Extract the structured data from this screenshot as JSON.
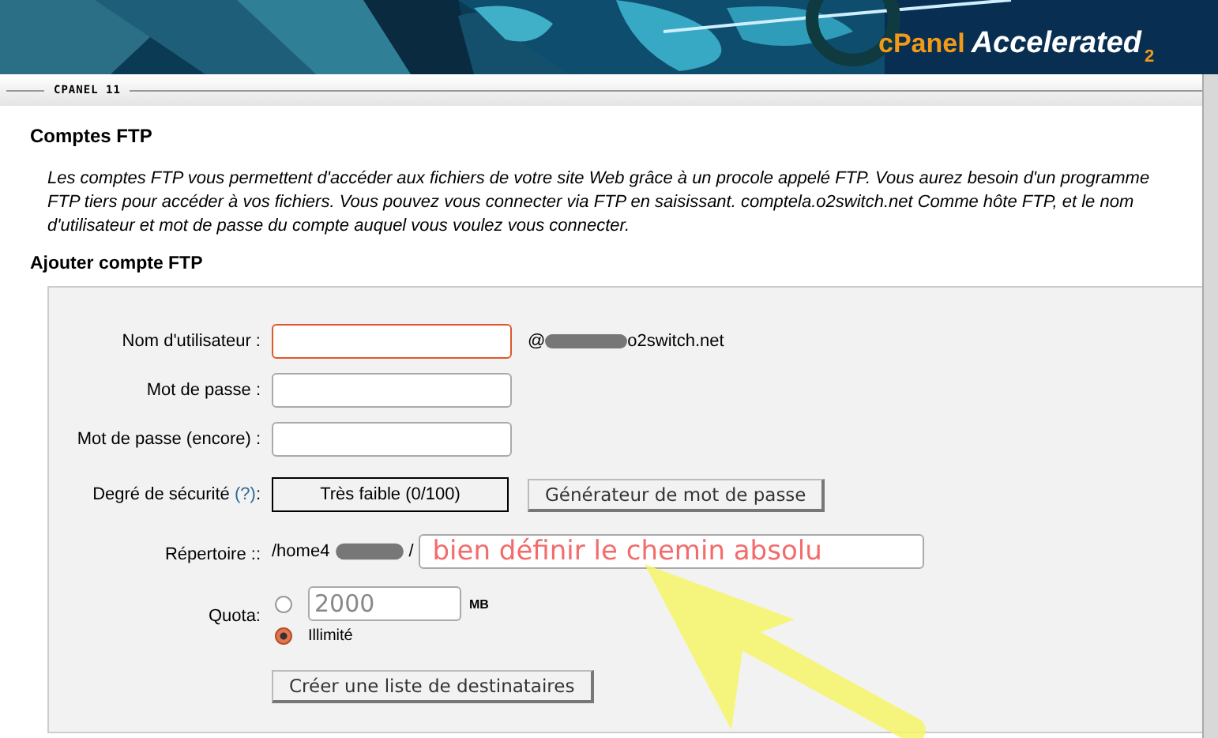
{
  "header": {
    "logo_brand": "cPanel",
    "logo_product": "Accelerated",
    "logo_version": "2",
    "version_tab": "CPANEL 11"
  },
  "page": {
    "title": "Comptes FTP",
    "description": "Les comptes FTP vous permettent d'accéder aux fichiers de votre site Web grâce à un procole appelé FTP. Vous aurez besoin d'un programme FTP tiers pour accéder à vos fichiers. Vous pouvez vous connecter via FTP en saisissant. comptela.o2switch.net Comme hôte FTP, et le nom d'utilisateur et mot de passe du compte auquel vous voulez vous connecter.",
    "section_title": "Ajouter compte FTP"
  },
  "form": {
    "username": {
      "label": "Nom d'utilisateur :",
      "focused": true,
      "domain_prefix": "@",
      "domain_suffix": "o2switch.net"
    },
    "password": {
      "label": "Mot de passe :"
    },
    "password_again": {
      "label": "Mot de passe (encore) :"
    },
    "strength": {
      "label": "Degré de sécurité",
      "help": "(?)",
      "colon": ":",
      "value": "Très faible (0/100)",
      "generator_button": "Générateur de mot de passe"
    },
    "directory": {
      "label": "Répertoire ::",
      "prefix": "/home4",
      "suffix": "/",
      "value": "bien définir le chemin absolu"
    },
    "quota": {
      "label": "Quota:",
      "options": [
        {
          "kind": "amount",
          "selected": false,
          "placeholder": "2000",
          "unit": "MB"
        },
        {
          "kind": "unlimited",
          "selected": true,
          "label": "Illimité"
        }
      ]
    },
    "create_list_button": "Créer une liste de destinataires"
  }
}
